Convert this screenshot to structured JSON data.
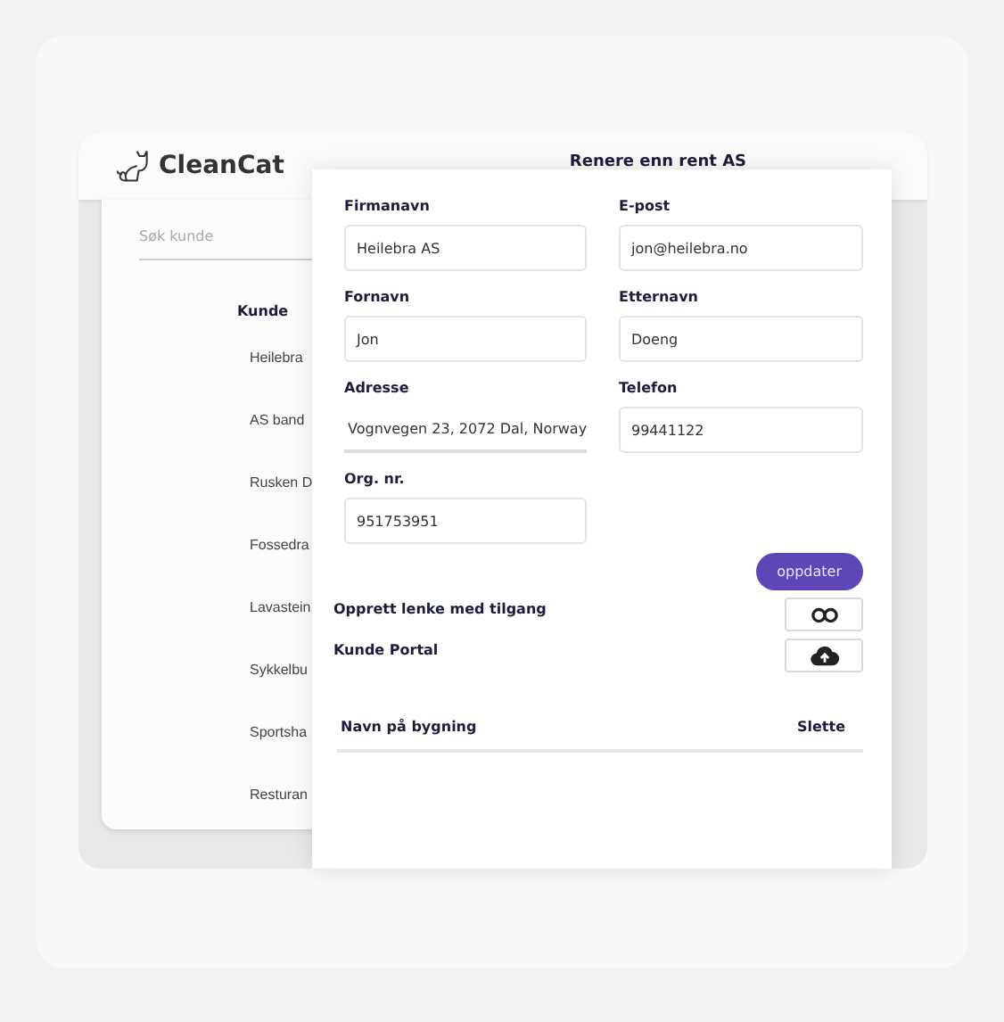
{
  "app": {
    "logo": "CleanCat",
    "title": "Renere enn rent AS"
  },
  "customers": {
    "search": {
      "placeholder": "Søk kunde"
    },
    "heading": "Kunde",
    "rows": [
      "Heilebra",
      "AS band",
      "Rusken D",
      "Fossedra",
      "Lavastein",
      "Sykkelbu",
      "Sportsha",
      "Resturan"
    ]
  },
  "form": {
    "fields": [
      {
        "label": "Firmanavn",
        "value": "Heilebra AS",
        "kind": "box"
      },
      {
        "label": "E-post",
        "value": "jon@heilebra.no",
        "kind": "box"
      },
      {
        "label": "Fornavn",
        "value": "Jon",
        "kind": "box"
      },
      {
        "label": "Etternavn",
        "value": "Doeng",
        "kind": "box"
      },
      {
        "label": "Adresse",
        "value": "Vognvegen 23, 2072 Dal, Norway",
        "kind": "underline"
      },
      {
        "label": "Telefon",
        "value": "99441122",
        "kind": "box"
      },
      {
        "label": "Org. nr.",
        "value": "951753951",
        "kind": "box"
      }
    ],
    "submit": "oppdater",
    "actions": [
      {
        "label": "Opprett lenke med tilgang",
        "kind": "link"
      },
      {
        "label": "Kunde Portal",
        "kind": "upload"
      }
    ],
    "table": {
      "columns": [
        "Navn på bygning",
        "Slette"
      ]
    }
  }
}
